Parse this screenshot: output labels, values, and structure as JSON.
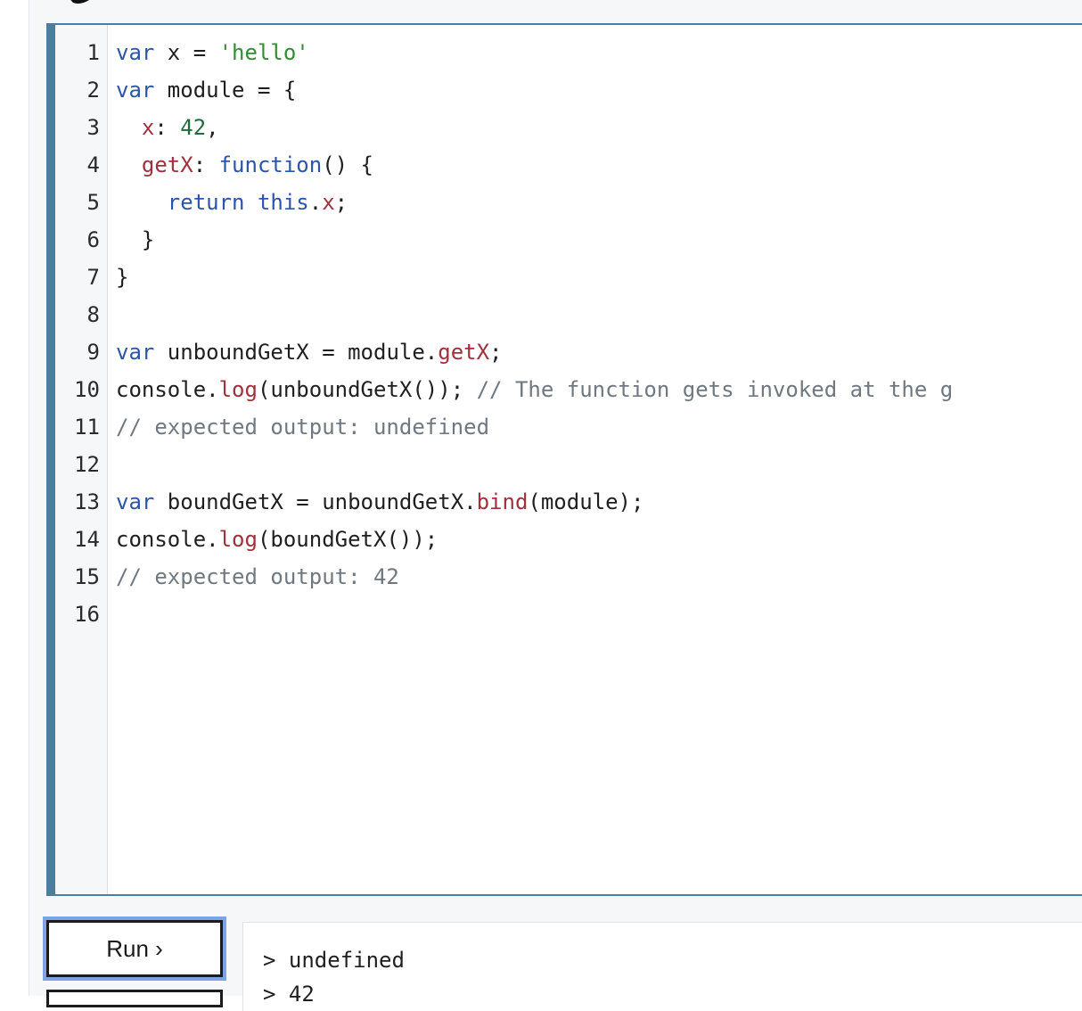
{
  "editor": {
    "line_numbers": [
      "1",
      "2",
      "3",
      "4",
      "5",
      "6",
      "7",
      "8",
      "9",
      "10",
      "11",
      "12",
      "13",
      "14",
      "15",
      "16"
    ],
    "lines": [
      [
        {
          "t": "var",
          "c": "kw"
        },
        {
          "t": " x = ",
          "c": "pun"
        },
        {
          "t": "'hello'",
          "c": "str"
        }
      ],
      [
        {
          "t": "var",
          "c": "kw"
        },
        {
          "t": " module = {",
          "c": "pun"
        }
      ],
      [
        {
          "t": "  ",
          "c": "pun"
        },
        {
          "t": "x",
          "c": "prop"
        },
        {
          "t": ": ",
          "c": "pun"
        },
        {
          "t": "42",
          "c": "num"
        },
        {
          "t": ",",
          "c": "pun"
        }
      ],
      [
        {
          "t": "  ",
          "c": "pun"
        },
        {
          "t": "getX",
          "c": "prop"
        },
        {
          "t": ": ",
          "c": "pun"
        },
        {
          "t": "function",
          "c": "kw"
        },
        {
          "t": "() {",
          "c": "pun"
        }
      ],
      [
        {
          "t": "    ",
          "c": "pun"
        },
        {
          "t": "return",
          "c": "kw"
        },
        {
          "t": " ",
          "c": "pun"
        },
        {
          "t": "this",
          "c": "kw"
        },
        {
          "t": ".",
          "c": "pun"
        },
        {
          "t": "x",
          "c": "prop"
        },
        {
          "t": ";",
          "c": "pun"
        }
      ],
      [
        {
          "t": "  }",
          "c": "pun"
        }
      ],
      [
        {
          "t": "}",
          "c": "pun"
        }
      ],
      [],
      [
        {
          "t": "var",
          "c": "kw"
        },
        {
          "t": " unboundGetX = module.",
          "c": "pun"
        },
        {
          "t": "getX",
          "c": "prop"
        },
        {
          "t": ";",
          "c": "pun"
        }
      ],
      [
        {
          "t": "console.",
          "c": "pun"
        },
        {
          "t": "log",
          "c": "prop"
        },
        {
          "t": "(unboundGetX()); ",
          "c": "pun"
        },
        {
          "t": "// The function gets invoked at the g",
          "c": "cmt"
        }
      ],
      [
        {
          "t": "// expected output: undefined",
          "c": "cmt"
        }
      ],
      [],
      [
        {
          "t": "var",
          "c": "kw"
        },
        {
          "t": " boundGetX = unboundGetX.",
          "c": "pun"
        },
        {
          "t": "bind",
          "c": "prop"
        },
        {
          "t": "(module);",
          "c": "pun"
        }
      ],
      [
        {
          "t": "console.",
          "c": "pun"
        },
        {
          "t": "log",
          "c": "prop"
        },
        {
          "t": "(boundGetX());",
          "c": "pun"
        }
      ],
      [
        {
          "t": "// expected output: 42",
          "c": "cmt"
        }
      ],
      []
    ]
  },
  "run_button": {
    "label": "Run ›"
  },
  "console": {
    "lines": [
      "> undefined",
      "> 42"
    ]
  }
}
